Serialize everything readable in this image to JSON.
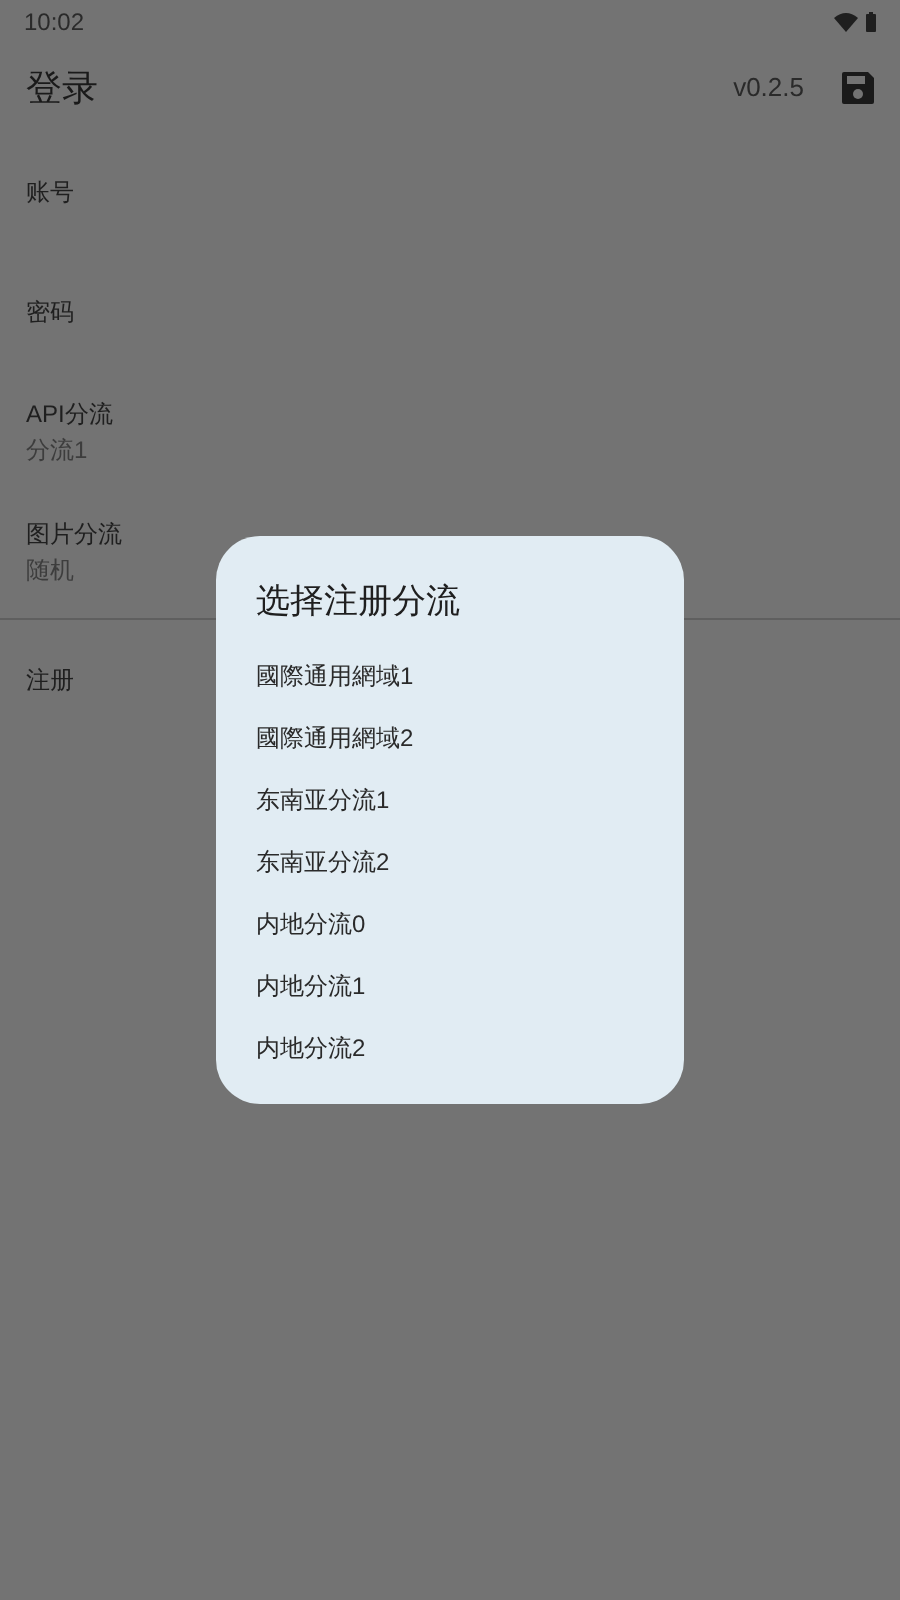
{
  "status_bar": {
    "time": "10:02"
  },
  "app_bar": {
    "title": "登录",
    "version": "v0.2.5"
  },
  "settings": [
    {
      "label": "账号"
    },
    {
      "label": "密码"
    },
    {
      "label": "API分流",
      "value": "分流1"
    },
    {
      "label": "图片分流",
      "value": "随机"
    }
  ],
  "actions": [
    {
      "label": "注册"
    }
  ],
  "dialog": {
    "title": "选择注册分流",
    "options": [
      "國際通用網域1",
      "國際通用網域2",
      "东南亚分流1",
      "东南亚分流2",
      "内地分流0",
      "内地分流1",
      "内地分流2"
    ]
  }
}
